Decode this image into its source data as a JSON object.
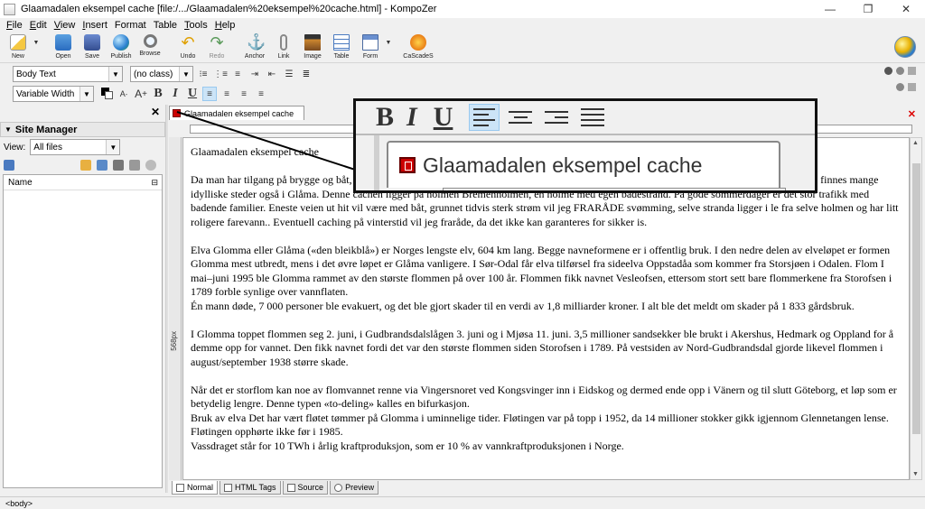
{
  "window": {
    "title": "Glaamadalen eksempel cache [file:/.../Glaamadalen%20eksempel%20cache.html] - KompoZer"
  },
  "menu": [
    {
      "acc": "F",
      "rest": "ile"
    },
    {
      "acc": "E",
      "rest": "dit"
    },
    {
      "acc": "V",
      "rest": "iew"
    },
    {
      "acc": "I",
      "rest": "nsert"
    },
    {
      "acc": "",
      "rest": "Format"
    },
    {
      "acc": "",
      "rest": "Table"
    },
    {
      "acc": "T",
      "rest": "ools"
    },
    {
      "acc": "H",
      "rest": "elp"
    }
  ],
  "toolbar": {
    "new": "New",
    "open": "Open",
    "save": "Save",
    "publish": "Publish",
    "browse": "Browse",
    "undo": "Undo",
    "redo": "Redo",
    "anchor": "Anchor",
    "link": "Link",
    "image": "Image",
    "table": "Table",
    "form": "Form",
    "cascades": "CaScadeS"
  },
  "format": {
    "paragraph_style": "Body Text",
    "class": "(no class)",
    "font": "Variable Width"
  },
  "site_manager": {
    "title": "Site Manager",
    "view_label": "View:",
    "view_value": "All files",
    "name_col": "Name"
  },
  "document": {
    "tab_label": "Glaamadalen eksempel cache",
    "width_label": "568px",
    "paragraphs": [
      "Glaamadalen eksempel cache",
      "Da man har tilgang på brygge og båt, men det er også lov til og ta seg frem på andre måter. De fleste ligger ved holmen Bremenholmen, men det finnes mange idylliske steder også i Glåma. Denne cachen ligger på holmen Bremenholmen, en holme med egen badestrand. På gode sommerdager er det stor trafikk med badende familier. Eneste veien ut hit vil være med båt, grunnet tidvis sterk strøm vil jeg FRARÅDE svømming, selve stranda ligger i le fra selve holmen og har litt roligere farevann.. Eventuell caching på vinterstid vil jeg  fraråde, da det ikke kan garanteres for sikker is.",
      "Elva Glomma eller Glåma («den bleikblå») er Norges lengste elv, 604 km lang. Begge navneformene er i offentlig bruk. I den nedre delen av elveløpet er formen Glomma mest utbredt, mens i det øvre løpet er Glåma vanligere. I Sør-Odal får elva tilførsel fra sideelva Oppstadåa som kommer fra Storsjøen i Odalen. Flom I mai–juni 1995 ble Glomma rammet av den største flommen på over 100 år. Flommen fikk navnet Vesleofsen, ettersom stort sett bare flommerkene fra Storofsen i 1789 forble synlige over vannflaten.",
      " Én mann døde, 7 000 personer ble evakuert, og det ble gjort skader til en verdi av 1,8 milliarder kroner. I alt ble det meldt om skader på 1 833 gårdsbruk.",
      "I Glomma toppet flommen seg 2. juni, i Gudbrandsdalslågen 3. juni og i Mjøsa 11. juni. 3,5 millioner sandsekker ble brukt i Akershus, Hedmark og Oppland for å demme opp for vannet. Den fikk navnet fordi det var den største flommen siden Storofsen i 1789. På vestsiden av Nord-Gudbrandsdal gjorde likevel flommen i august/september 1938 større skade.",
      "Når det er storflom kan noe av flomvannet renne via Vingersnoret ved Kongsvinger inn i Eidskog og dermed ende opp i Vänern og til slutt Göteborg, et løp som er betydelig lengre. Denne typen «to-deling» kalles en bifurkasjon.",
      "Bruk av elva Det har vært fløtet tømmer på Glomma i uminnelige tider. Fløtingen var på topp i 1952, da 14 millioner stokker gikk igjennom Glennetangen lense. Fløtingen opphørte ikke før i 1985.",
      "Vassdraget står for 10 TWh i årlig kraftproduksjon, som er 10 % av vannkraftproduksjonen i Norge."
    ]
  },
  "mode_tabs": [
    "Normal",
    "HTML Tags",
    "Source",
    "Preview"
  ],
  "status": "<body>",
  "callout": {
    "bold": "B",
    "italic": "I",
    "underline": "U",
    "tab_label": "Glaamadalen eksempel cache"
  }
}
